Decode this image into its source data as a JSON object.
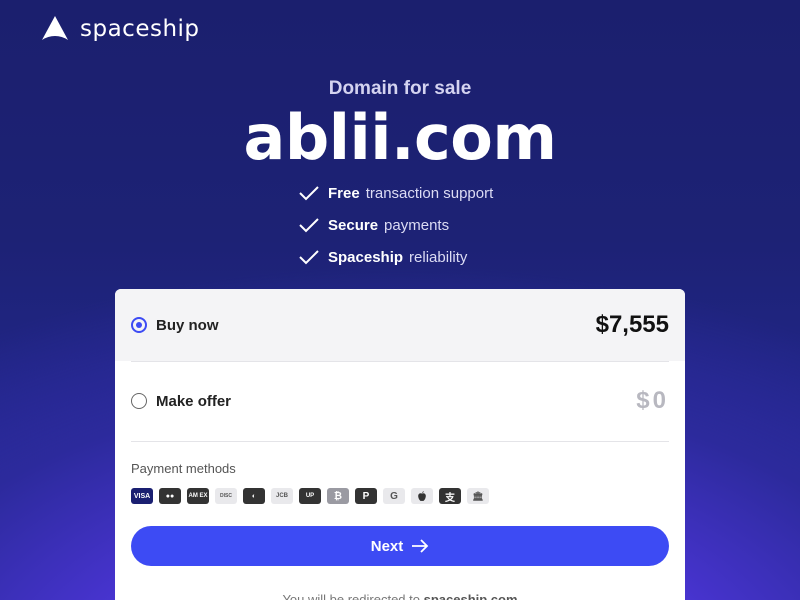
{
  "brand": {
    "name": "spaceship"
  },
  "hero": {
    "subtitle": "Domain for sale",
    "domain": "ablii.com"
  },
  "features": [
    {
      "strong": "Free",
      "rest": "transaction support"
    },
    {
      "strong": "Secure",
      "rest": "payments"
    },
    {
      "strong": "Spaceship",
      "rest": "reliability"
    }
  ],
  "options": {
    "buy": {
      "label": "Buy now",
      "price": "$7,555",
      "selected": true
    },
    "offer": {
      "label": "Make offer",
      "price": "$0",
      "selected": false
    }
  },
  "payment": {
    "label": "Payment methods",
    "methods": [
      {
        "name": "visa",
        "text": "VISA"
      },
      {
        "name": "mastercard",
        "text": "●●"
      },
      {
        "name": "amex",
        "text": "AM EX"
      },
      {
        "name": "discover",
        "text": "DISC"
      },
      {
        "name": "diners",
        "text": "◐"
      },
      {
        "name": "jcb",
        "text": "JCB"
      },
      {
        "name": "unionpay",
        "text": "UP"
      },
      {
        "name": "bitcoin",
        "text": "₿"
      },
      {
        "name": "paypal",
        "text": "P"
      },
      {
        "name": "google-pay",
        "text": "G"
      },
      {
        "name": "apple-pay",
        "text": ""
      },
      {
        "name": "alipay",
        "text": "支"
      },
      {
        "name": "bank-transfer",
        "text": "🏛"
      }
    ]
  },
  "next_button": {
    "label": "Next"
  },
  "redirect": {
    "prefix": "You will be redirected to ",
    "site": "spaceship.com"
  },
  "colors": {
    "accent": "#3d4bf4",
    "background_top": "#1b1f6e",
    "background_glow": "#6a3df0"
  }
}
